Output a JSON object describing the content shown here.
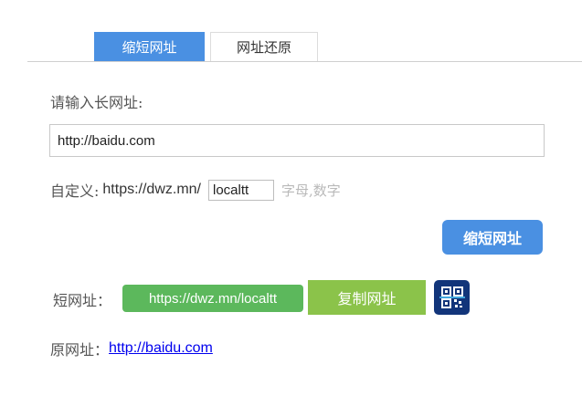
{
  "tabs": {
    "shorten_label": "缩短网址",
    "restore_label": "网址还原"
  },
  "form": {
    "long_url_label": "请输入长网址:",
    "long_url_value": "http://baidu.com",
    "custom_label": "自定义:",
    "custom_prefix": "https://dwz.mn/",
    "custom_value": "localtt",
    "custom_hint": "字母,数字",
    "submit_label": "缩短网址"
  },
  "result": {
    "short_label": "短网址：",
    "short_url": "https://dwz.mn/localtt",
    "copy_label": "复制网址",
    "original_label": "原网址：",
    "original_url": "http://baidu.com"
  },
  "icons": {
    "qr_button": "qr-code-scan-icon"
  },
  "colors": {
    "tab_active_bg": "#4a90e2",
    "submit_bg": "#4a90e2",
    "short_url_bg": "#5cb85c",
    "copy_bg": "#8bc34a",
    "qr_bg": "#12357a",
    "hint_text": "#b9b9b9",
    "link": "#0000ee"
  }
}
